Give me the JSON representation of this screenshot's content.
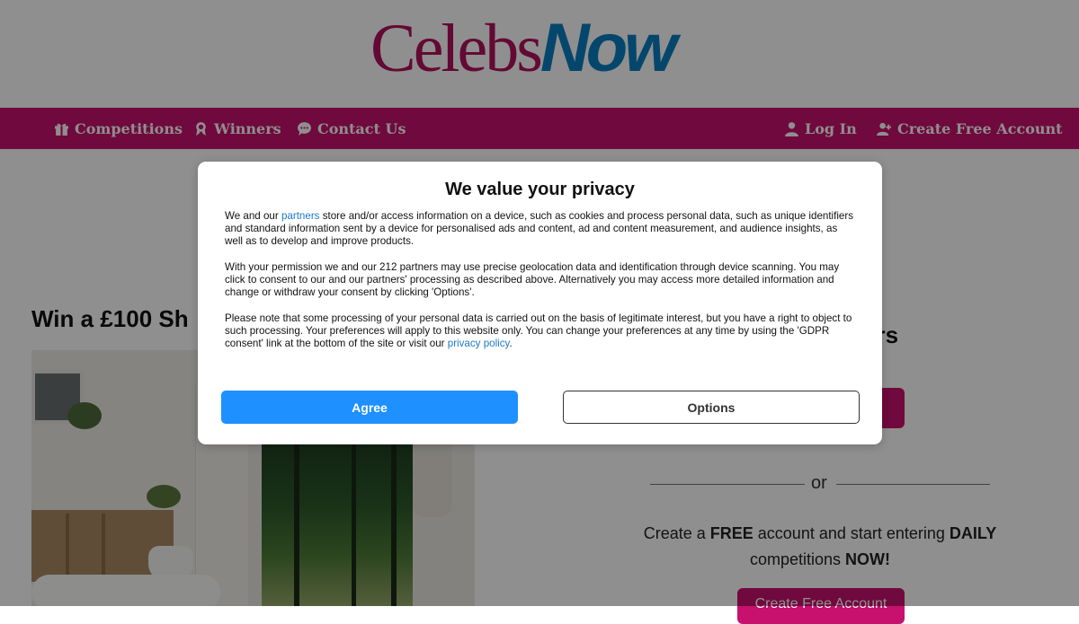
{
  "logo": {
    "part1": "Celebs",
    "part2": "Now"
  },
  "nav": {
    "left": [
      {
        "label": "Competitions",
        "icon": "gift-icon"
      },
      {
        "label": "Winners",
        "icon": "award-icon"
      },
      {
        "label": "Contact Us",
        "icon": "chat-icon"
      }
    ],
    "right": [
      {
        "label": "Log In",
        "icon": "user-icon"
      },
      {
        "label": "Create Free Account",
        "icon": "user-plus-icon"
      }
    ]
  },
  "promo": {
    "title": "Win a £100 Sh"
  },
  "sidebar": {
    "title_partial": "ers",
    "or": "or",
    "text_1": "Create a ",
    "text_free": "FREE",
    "text_2": " account and start entering ",
    "text_daily": "DAILY",
    "text_3": " competitions ",
    "text_now": "NOW!",
    "bottom_button": "Create Free Account"
  },
  "consent": {
    "title": "We value your privacy",
    "p1_before": "We and our ",
    "p1_link": "partners",
    "p1_after": " store and/or access information on a device, such as cookies and process personal data, such as unique identifiers and standard information sent by a device for personalised ads and content, ad and content measurement, and audience insights, as well as to develop and improve products.",
    "p2": "With your permission we and our 212 partners may use precise geolocation data and identification through device scanning. You may click to consent to our and our partners' processing as described above. Alternatively you may access more detailed information and change or withdraw your consent by clicking 'Options'.",
    "p3_before": "Please note that some processing of your personal data is carried out on the basis of legitimate interest, but you have a right to object to such processing. Your preferences will apply to this website only. You can change your preferences at any time by using the 'GDPR consent' link at the bottom of the site or visit our ",
    "p3_link": "privacy policy",
    "p3_after": ".",
    "agree": "Agree",
    "options": "Options"
  },
  "colors": {
    "brand": "#c8106e",
    "accent": "#1e90ff",
    "logo_blue": "#0a7fc0"
  }
}
